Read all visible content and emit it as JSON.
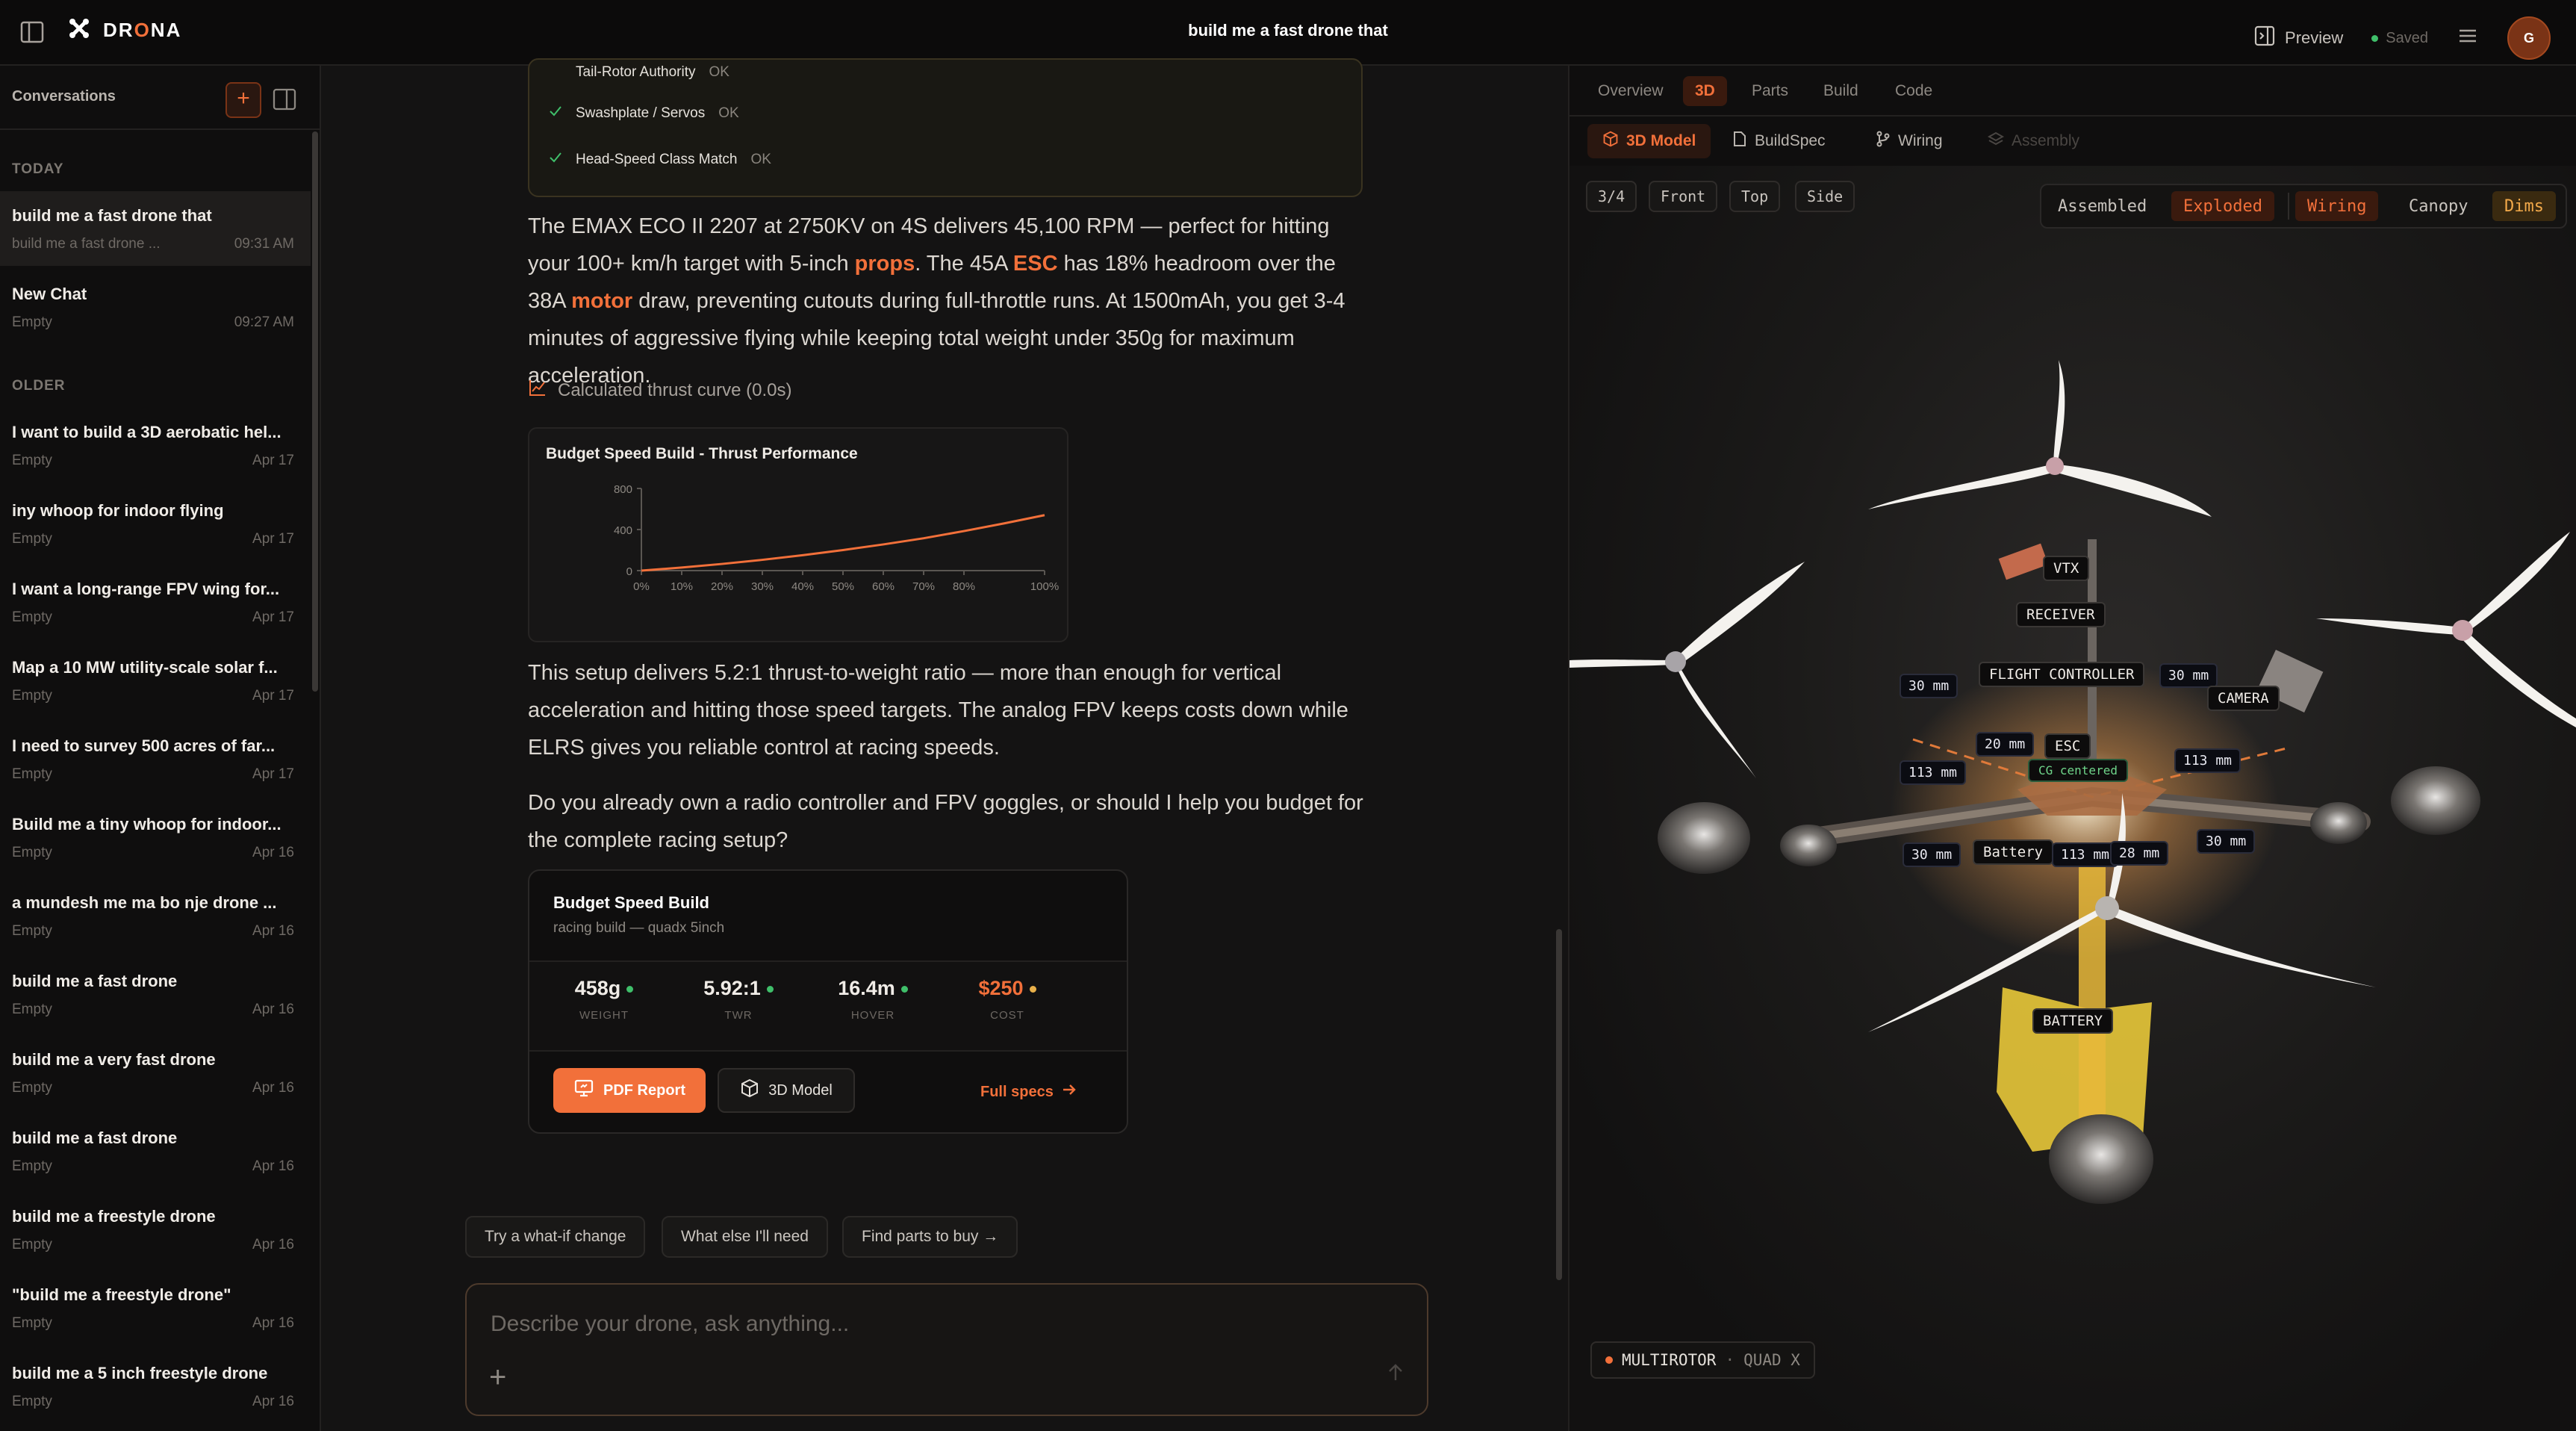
{
  "app": {
    "brand": "DRONA",
    "conversation_title": "build me a fast drone that",
    "preview_label": "Preview",
    "saved_label": "Saved",
    "avatar_initial": "G",
    "accent": "#f2703a"
  },
  "sidebar": {
    "title": "Conversations",
    "today_label": "TODAY",
    "older_label": "OLDER",
    "today": [
      {
        "title": "build me a fast drone that",
        "sub": "build me a fast drone ...",
        "time": "09:31 AM"
      },
      {
        "title": "New Chat",
        "sub": "Empty",
        "time": "09:27 AM"
      }
    ],
    "older": [
      {
        "title": "I want to build a 3D aerobatic hel...",
        "sub": "Empty",
        "time": "Apr 17"
      },
      {
        "title": "iny whoop for indoor flying",
        "sub": "Empty",
        "time": "Apr 17"
      },
      {
        "title": "I want a long-range FPV wing for...",
        "sub": "Empty",
        "time": "Apr 17"
      },
      {
        "title": "Map a 10 MW utility-scale solar f...",
        "sub": "Empty",
        "time": "Apr 17"
      },
      {
        "title": "I need to survey 500 acres of far...",
        "sub": "Empty",
        "time": "Apr 17"
      },
      {
        "title": "Build me a tiny whoop for indoor...",
        "sub": "Empty",
        "time": "Apr 16"
      },
      {
        "title": "a mundesh me ma bo nje drone ...",
        "sub": "Empty",
        "time": "Apr 16"
      },
      {
        "title": "build me a fast drone",
        "sub": "Empty",
        "time": "Apr 16"
      },
      {
        "title": "build me a very fast drone",
        "sub": "Empty",
        "time": "Apr 16"
      },
      {
        "title": "build me a fast drone",
        "sub": "Empty",
        "time": "Apr 16"
      },
      {
        "title": "build me a freestyle drone",
        "sub": "Empty",
        "time": "Apr 16"
      },
      {
        "title": "\"build me a freestyle drone\"",
        "sub": "Empty",
        "time": "Apr 16"
      },
      {
        "title": "build me a 5 inch freestyle drone",
        "sub": "Empty",
        "time": "Apr 16"
      }
    ]
  },
  "chat": {
    "checks": [
      {
        "label": "Tail-Rotor Authority",
        "status": "OK"
      },
      {
        "label": "Swashplate / Servos",
        "status": "OK"
      },
      {
        "label": "Head-Speed Class Match",
        "status": "OK"
      }
    ],
    "p1": {
      "a": "The EMAX ECO II 2207 at 2750KV on 4S delivers 45,100 RPM — perfect for hitting your 100+ km/h target with 5-inch ",
      "props": "props",
      "b": ". The 45A ",
      "esc": "ESC",
      "c": " has 18% headroom over the 38A ",
      "motor": "motor",
      "d": " draw, preventing cutouts during full-throttle runs. At 1500mAh, you get 3-4 minutes of aggressive flying while keeping total weight under 350g for maximum acceleration."
    },
    "thrust_note": "Calculated thrust curve (0.0s)",
    "p2": "This setup delivers 5.2:1 thrust-to-weight ratio — more than enough for vertical acceleration and hitting those speed targets. The analog FPV keeps costs down while ELRS gives you reliable control at racing speeds.",
    "p3": "Do you already own a radio controller and FPV goggles, or should I help you budget for the complete racing setup?",
    "build_card": {
      "title": "Budget Speed Build",
      "subtitle": "racing build — quadx 5inch",
      "stats": [
        {
          "value": "458g",
          "label": "WEIGHT",
          "dot": "#3fbf6a",
          "color": "#f0ece7"
        },
        {
          "value": "5.92:1",
          "label": "TWR",
          "dot": "#3fbf6a",
          "color": "#f0ece7"
        },
        {
          "value": "16.4m",
          "label": "HOVER",
          "dot": "#3fbf6a",
          "color": "#f0ece7"
        },
        {
          "value": "$250",
          "label": "COST",
          "dot": "#e8b04a",
          "color": "#f2703a"
        }
      ],
      "pdf_label": "PDF Report",
      "model_label": "3D Model",
      "full_specs_label": "Full specs"
    },
    "chips": [
      "Try a what-if change",
      "What else I'll need",
      "Find parts to buy →"
    ],
    "composer_placeholder": "Describe your drone, ask anything..."
  },
  "chart_data": {
    "type": "line",
    "title": "Budget Speed Build - Thrust Performance",
    "x_ticks": [
      "0%",
      "10%",
      "20%",
      "30%",
      "40%",
      "50%",
      "60%",
      "70%",
      "80%",
      "100%"
    ],
    "x": [
      0,
      10,
      20,
      30,
      40,
      50,
      60,
      70,
      80,
      90,
      100
    ],
    "series": [
      {
        "values": [
          0,
          30,
          65,
          105,
          150,
          200,
          255,
          315,
          385,
          460,
          540
        ],
        "color": "#f2703a"
      }
    ],
    "y_ticks": [
      "800",
      "400",
      "0"
    ],
    "ylim": [
      0,
      800
    ],
    "xlim": [
      0,
      100
    ],
    "grid": false
  },
  "right": {
    "tabs": [
      "Overview",
      "3D",
      "Parts",
      "Build",
      "Code"
    ],
    "active_tab": "3D",
    "subtabs": [
      "3D Model",
      "BuildSpec",
      "Wiring",
      "Assembly"
    ],
    "view_buttons": [
      "3/4",
      "Front",
      "Top",
      "Side"
    ],
    "mode_buttons": [
      "Assembled",
      "Exploded",
      "Wiring",
      "Canopy",
      "Dims"
    ],
    "component_labels": [
      "VTX",
      "RECEIVER",
      "FLIGHT CONTROLLER",
      "CAMERA",
      "ESC",
      "Battery",
      "BATTERY",
      "CG centered"
    ],
    "dimension_labels": [
      "30 mm",
      "30 mm",
      "113 mm",
      "113 mm",
      "113 mm",
      "20 mm",
      "30 mm",
      "28 mm",
      "30 mm",
      "113 mm"
    ],
    "badge_type": "MULTIROTOR",
    "badge_sep": "·",
    "badge_sub": "QUAD X"
  }
}
